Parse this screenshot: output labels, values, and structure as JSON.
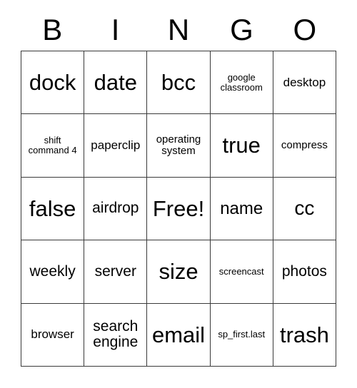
{
  "card": {
    "title": "BINGO",
    "header_letters": [
      "B",
      "I",
      "N",
      "G",
      "O"
    ],
    "free_space_label": "Free!",
    "grid_line_color": "#3a3a3a",
    "background_color": "#ffffff",
    "text_color": "#000000",
    "rows": 5,
    "columns": 5,
    "cells": [
      [
        {
          "label": "dock",
          "size": "fs-xxl"
        },
        {
          "label": "date",
          "size": "fs-xxl"
        },
        {
          "label": "bcc",
          "size": "fs-xxl"
        },
        {
          "label": "google classroom",
          "size": "fs-xxs"
        },
        {
          "label": "desktop",
          "size": "fs-sm"
        }
      ],
      [
        {
          "label": "shift command 4",
          "size": "fs-xxs"
        },
        {
          "label": "paperclip",
          "size": "fs-sm"
        },
        {
          "label": "operating system",
          "size": "fs-xs"
        },
        {
          "label": "true",
          "size": "fs-xxl"
        },
        {
          "label": "compress",
          "size": "fs-xs"
        }
      ],
      [
        {
          "label": "false",
          "size": "fs-xxl"
        },
        {
          "label": "airdrop",
          "size": "fs-md"
        },
        {
          "label": "Free!",
          "size": "fs-xxl"
        },
        {
          "label": "name",
          "size": "fs-lg"
        },
        {
          "label": "cc",
          "size": "fs-xl"
        }
      ],
      [
        {
          "label": "weekly",
          "size": "fs-md"
        },
        {
          "label": "server",
          "size": "fs-md"
        },
        {
          "label": "size",
          "size": "fs-xxl"
        },
        {
          "label": "screencast",
          "size": "fs-xxs"
        },
        {
          "label": "photos",
          "size": "fs-md"
        }
      ],
      [
        {
          "label": "browser",
          "size": "fs-sm"
        },
        {
          "label": "search engine",
          "size": "fs-md"
        },
        {
          "label": "email",
          "size": "fs-xxl"
        },
        {
          "label": "sp_first.last",
          "size": "fs-xxs"
        },
        {
          "label": "trash",
          "size": "fs-xxl"
        }
      ]
    ]
  }
}
